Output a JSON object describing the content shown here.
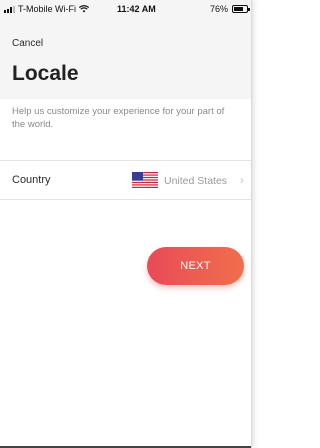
{
  "status_bar": {
    "carrier": "T-Mobile Wi-Fi",
    "time": "11:42 AM",
    "battery": "76%"
  },
  "nav": {
    "cancel_label": "Cancel"
  },
  "page": {
    "title": "Locale",
    "description": "Help us customize your experience for your part of the world."
  },
  "country_row": {
    "label": "Country",
    "value": "United States",
    "flag_icon": "us-flag-icon",
    "chevron": "›"
  },
  "next_button": {
    "label": "NEXT",
    "gradient_start": "#e84b57",
    "gradient_end": "#f16e4c"
  }
}
